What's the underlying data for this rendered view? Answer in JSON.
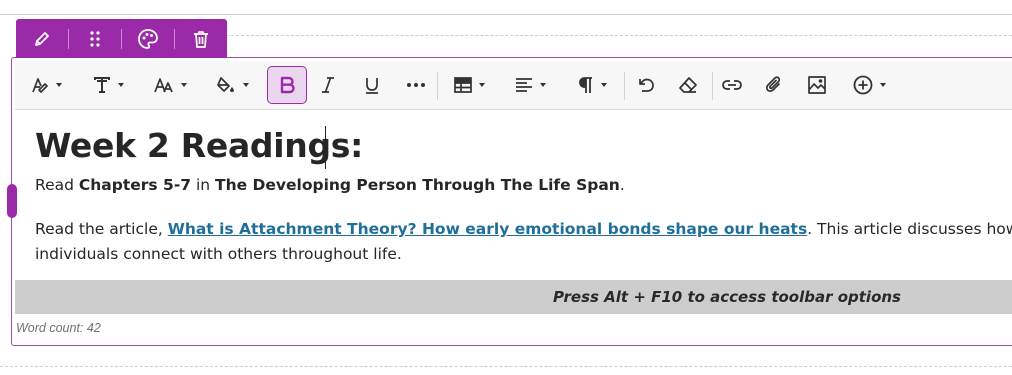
{
  "block_toolbar": {
    "buttons": [
      {
        "icon": "pencil-icon",
        "name": "edit-button"
      },
      {
        "icon": "drag-handle-icon",
        "name": "drag-button"
      },
      {
        "icon": "palette-icon",
        "name": "style-button"
      },
      {
        "icon": "trash-icon",
        "name": "delete-button"
      }
    ],
    "accent_color": "#9b2aa8"
  },
  "format_toolbar": {
    "items": [
      "text-style-icon",
      "font-family-icon",
      "font-size-icon",
      "highlight-color-icon",
      "bold-icon",
      "italic-icon",
      "underline-icon",
      "more-icon",
      "table-icon",
      "align-left-icon",
      "paragraph-icon",
      "undo-icon",
      "clear-format-icon",
      "link-icon",
      "attachment-icon",
      "image-icon",
      "insert-plus-icon"
    ],
    "active": "bold-icon"
  },
  "document": {
    "heading": "Week 2 Readings:",
    "p1": {
      "prefix": "Read ",
      "bold1": "Chapters 5-7",
      "mid": " in ",
      "bold2": "The Developing Person Through The Life Span",
      "suffix": "."
    },
    "p2": {
      "prefix": "Read the article, ",
      "link": "What is Attachment Theory? How early emotional bonds shape our heats",
      "suffix": ". This article discusses how fou",
      "line2": "individuals connect with others throughout life."
    }
  },
  "hint": "Press Alt + F10 to access toolbar options",
  "word_count": "Word count: 42"
}
